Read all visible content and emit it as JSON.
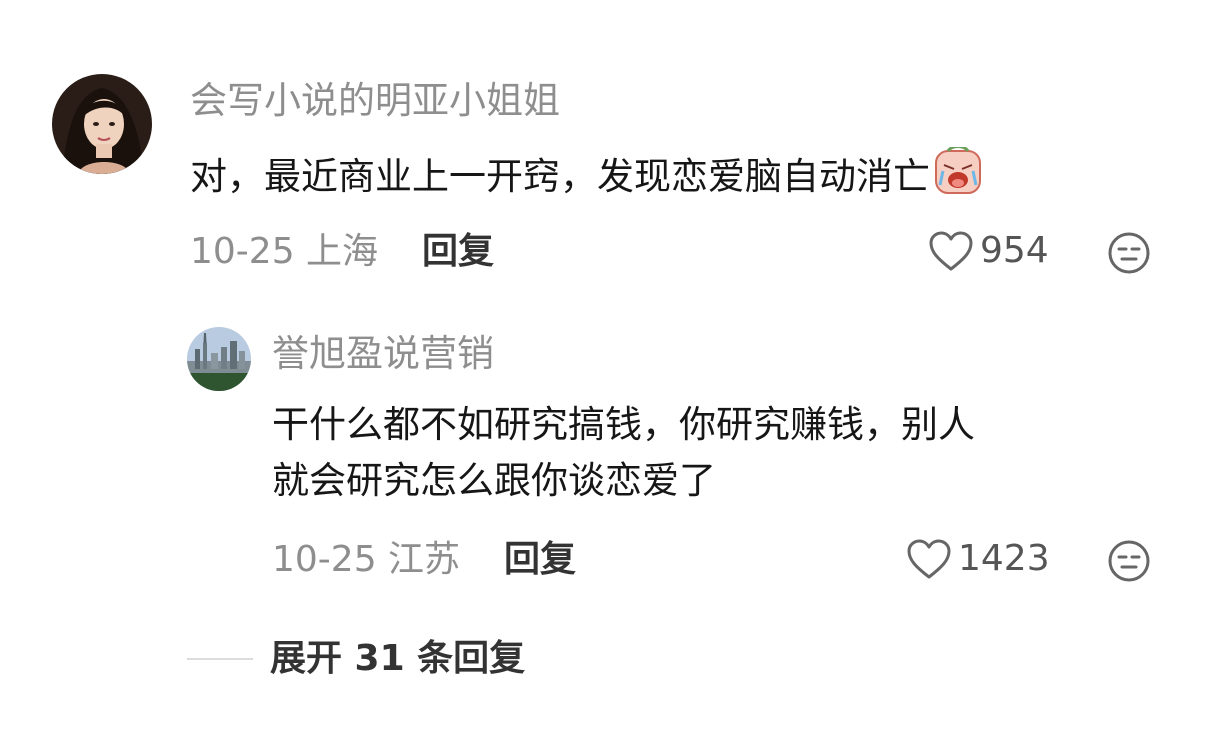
{
  "comments": [
    {
      "username": "会写小说的明亚小姐姐",
      "text": "对，最近商业上一开窍，发现恋爱脑自动消亡",
      "date_location": "10-25 上海",
      "reply_label": "回复",
      "likes": "954"
    }
  ],
  "replies": [
    {
      "username": "誉旭盈说营销",
      "text_line1": "干什么都不如研究搞钱，你研究赚钱，别人",
      "text_line2": "就会研究怎么跟你谈恋爱了",
      "date_location": "10-25 江苏",
      "reply_label": "回复",
      "likes": "1423"
    }
  ],
  "expand_label": "展开 31 条回复",
  "icons": {
    "like": "heart-outline-icon",
    "dislike": "neutral-face-icon",
    "emoji": "crying-emoji-icon"
  }
}
